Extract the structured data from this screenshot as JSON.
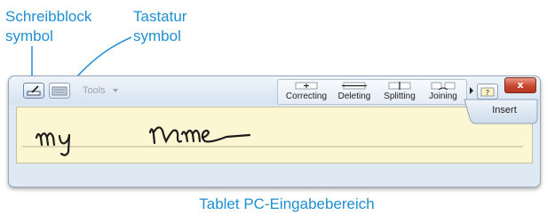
{
  "annotations": {
    "pen_icon_label_line1": "Schreibblock",
    "pen_icon_label_line2": "symbol",
    "keyboard_icon_label_line1": "Tastatur",
    "keyboard_icon_label_line2": "symbol",
    "caption": "Tablet PC-Eingabebereich"
  },
  "toolbar": {
    "tools_label": "Tools",
    "gestures": [
      {
        "label": "Correcting"
      },
      {
        "label": "Deleting"
      },
      {
        "label": "Splitting"
      },
      {
        "label": "Joining"
      }
    ],
    "close_label": "x"
  },
  "writing_pad": {
    "handwritten_text": "my name"
  },
  "insert_button": {
    "label": "Insert"
  },
  "colors": {
    "annotation": "#1f8fd2",
    "close_button": "#c7472f",
    "writing_background": "#fdf6d3"
  }
}
